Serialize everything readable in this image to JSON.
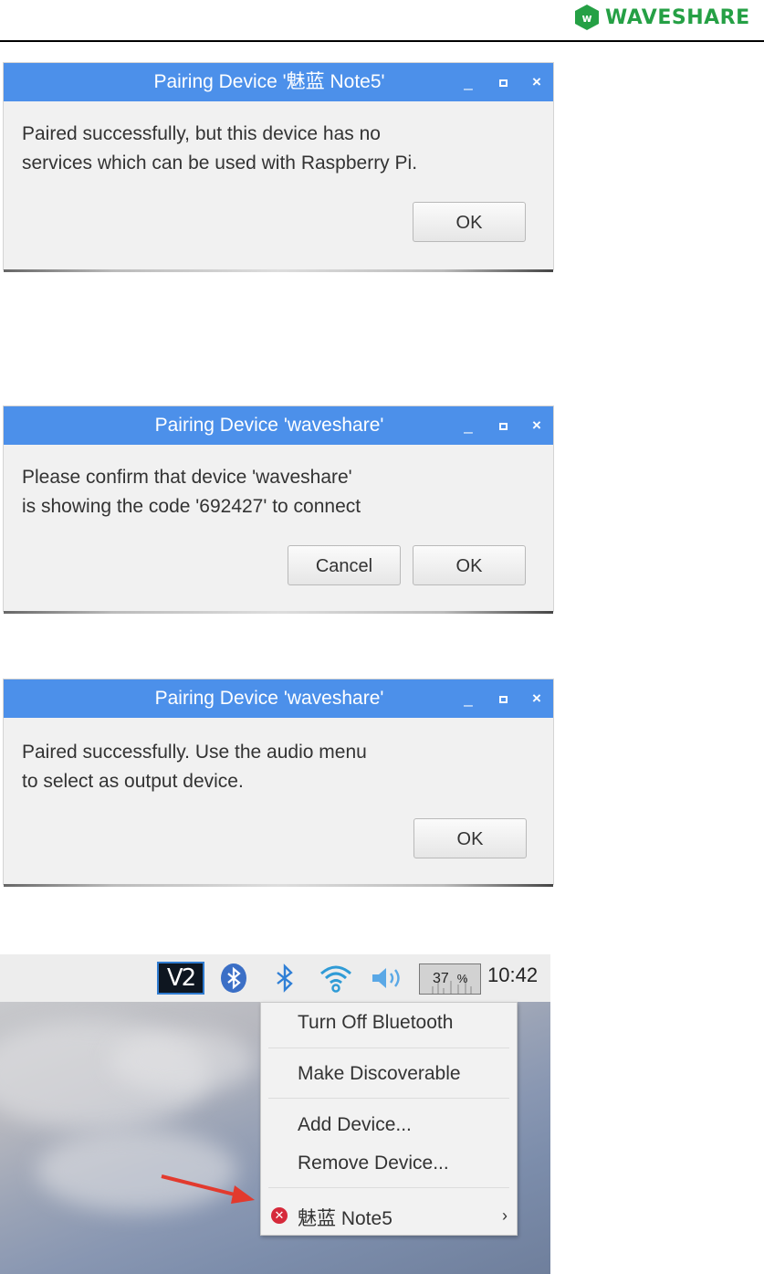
{
  "header": {
    "brand": "WAVESHARE",
    "brand_color": "#25a045"
  },
  "dialogs": [
    {
      "title": "Pairing Device '魅蓝 Note5'",
      "message_lines": [
        "Paired successfully, but this device has no",
        "services which can be used with Raspberry Pi."
      ],
      "buttons": {
        "ok": "OK"
      }
    },
    {
      "title": "Pairing Device 'waveshare'",
      "message_lines": [
        "Please confirm that device 'waveshare'",
        "is showing the code '692427' to connect"
      ],
      "buttons": {
        "cancel": "Cancel",
        "ok": "OK"
      }
    },
    {
      "title": "Pairing Device 'waveshare'",
      "message_lines": [
        "Paired successfully. Use the audio menu",
        "to select as output device."
      ],
      "buttons": {
        "ok": "OK"
      }
    }
  ],
  "titlebar_controls": {
    "minimize": "_",
    "close": "×"
  },
  "colors": {
    "titlebar": "#4c90ea",
    "dialog_bg": "#f1f1f1",
    "taskbar": "#ededed",
    "error_badge": "#d6293a",
    "arrow": "#e23a2e"
  },
  "taskbar": {
    "vnc_label": "V2",
    "cpu_value": "37",
    "cpu_unit": "%",
    "clock": "10:42",
    "icons": [
      "vnc-icon",
      "bluetooth-badge-icon",
      "bluetooth-icon",
      "wifi-icon",
      "volume-icon",
      "cpu-monitor"
    ]
  },
  "bluetooth_menu": {
    "items": [
      "Turn Off Bluetooth",
      "Make Discoverable",
      "Add Device...",
      "Remove Device..."
    ],
    "device_name": "魅蓝 Note5",
    "device_status_icon": "error-x-icon",
    "submenu_icon": "chevron-right-icon"
  }
}
